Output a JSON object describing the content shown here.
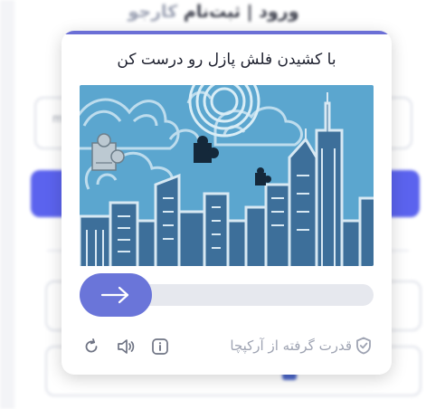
{
  "background_page": {
    "title_prefix": "ورود | ثبت‌نام",
    "title_brand": "کارجو",
    "input_hint": "m"
  },
  "captcha": {
    "instruction": "با کشیدن فلش پازل رو درست کن",
    "powered_by": "قدرت گرفته از آرکپچا",
    "slider_progress": 0,
    "icons": {
      "refresh": "refresh-icon",
      "audio": "speaker-icon",
      "info": "info-icon",
      "slider": "arrow-right-icon",
      "brand": "shield-check-icon"
    },
    "colors": {
      "accent": "#6a75d9",
      "sky": "#5ba6cf",
      "buildings": "#3d6f9a",
      "track": "#e6e8ee"
    }
  }
}
